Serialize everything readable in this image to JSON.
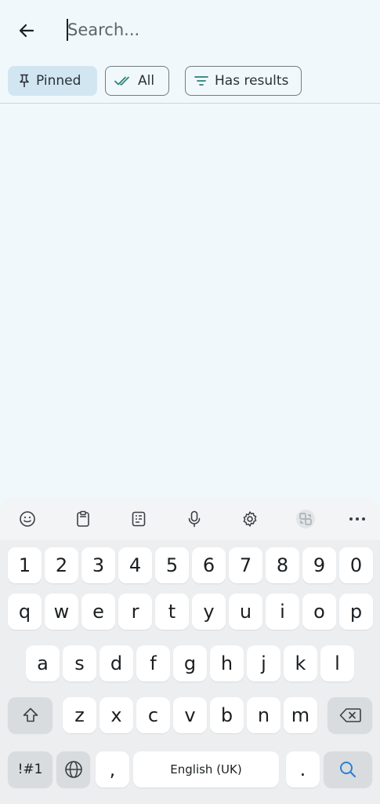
{
  "header": {
    "back_icon": "arrow-left-icon",
    "search_placeholder": "Search..."
  },
  "filters": [
    {
      "label": "Pinned",
      "icon": "pin-icon",
      "selected": true
    },
    {
      "label": "All",
      "icon": "double-check-icon",
      "selected": false
    },
    {
      "label": "Has results",
      "icon": "filter-lines-icon",
      "selected": false
    }
  ],
  "keyboard": {
    "toolbar": [
      "emoji-icon",
      "clipboard-icon",
      "text-extract-icon",
      "microphone-icon",
      "settings-icon",
      "translate-icon",
      "more-icon"
    ],
    "row_numbers": [
      "1",
      "2",
      "3",
      "4",
      "5",
      "6",
      "7",
      "8",
      "9",
      "0"
    ],
    "row1": [
      "q",
      "w",
      "e",
      "r",
      "t",
      "y",
      "u",
      "i",
      "o",
      "p"
    ],
    "row2": [
      "a",
      "s",
      "d",
      "f",
      "g",
      "h",
      "j",
      "k",
      "l"
    ],
    "row3": [
      "z",
      "x",
      "c",
      "v",
      "b",
      "n",
      "m"
    ],
    "symbols_label": "!#1",
    "comma": ",",
    "space_label": "English (UK)",
    "period": "."
  },
  "colors": {
    "background": "#f0f8fb",
    "chip_selected": "#d2e6f2",
    "search_key_icon": "#2f7fd1"
  }
}
